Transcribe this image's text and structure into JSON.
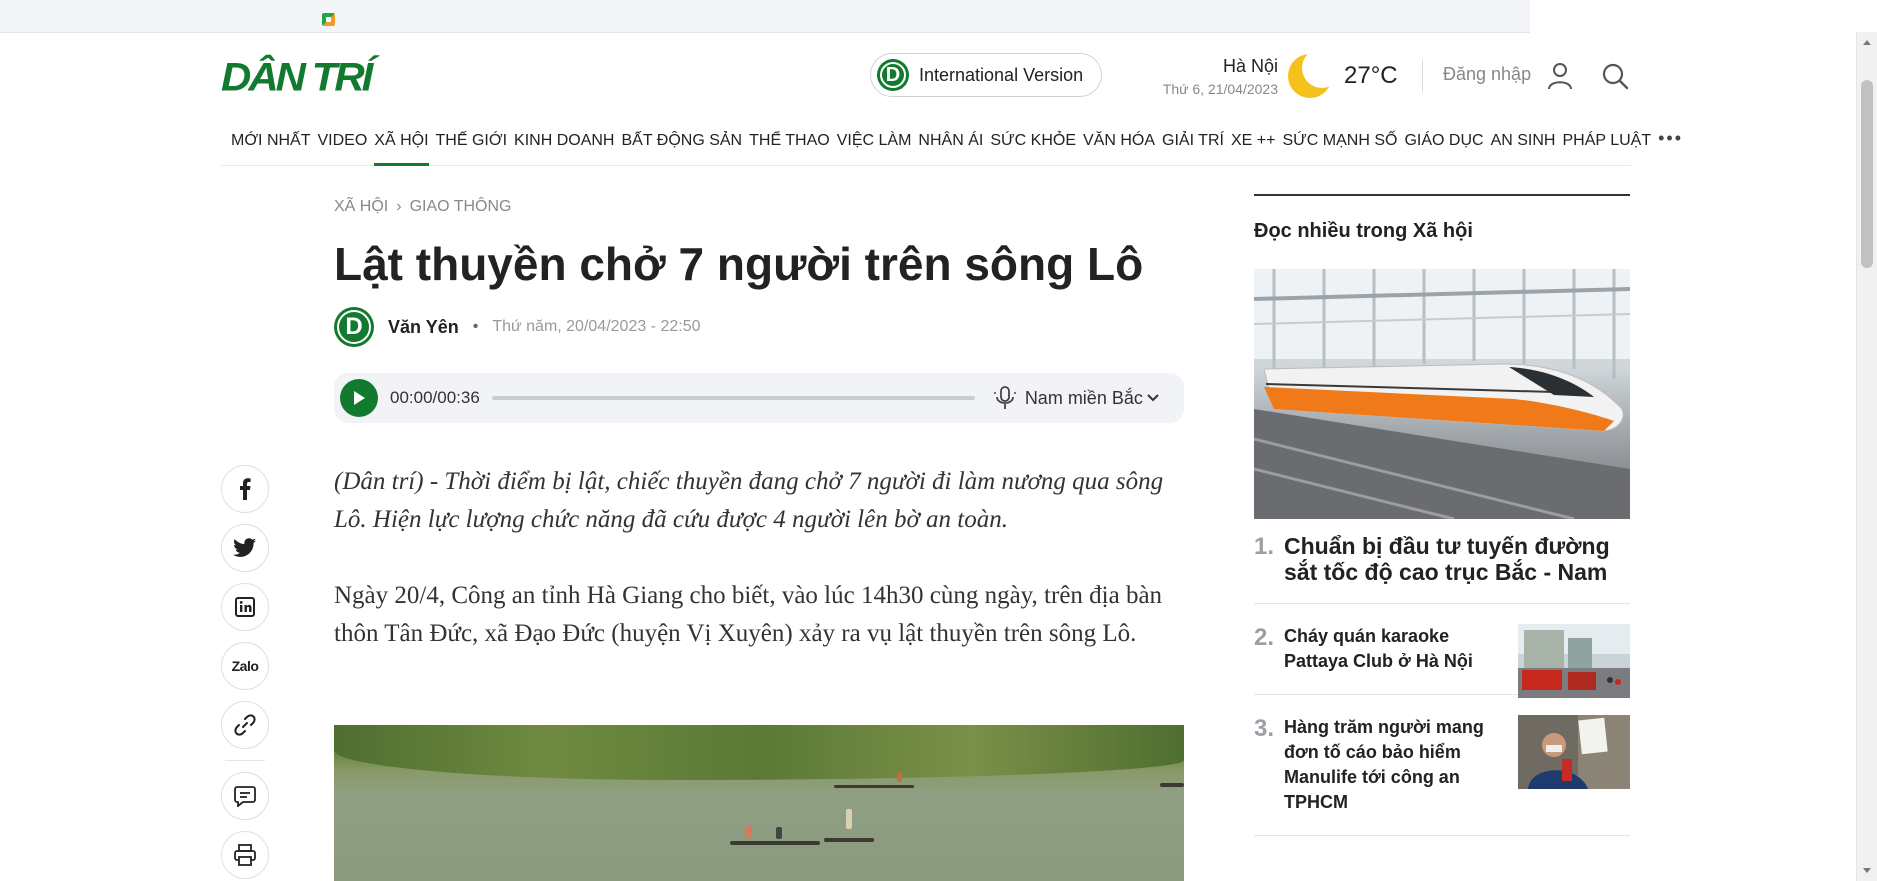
{
  "header": {
    "logo": "DÂN TRÍ",
    "intl_badge": "D",
    "intl_label": "International Version",
    "city": "Hà Nội",
    "date": "Thứ 6, 21/04/2023",
    "temperature": "27°C",
    "login_label": "Đăng nhập"
  },
  "nav": {
    "items": [
      "MỚI NHẤT",
      "VIDEO",
      "XÃ HỘI",
      "THẾ GIỚI",
      "KINH DOANH",
      "BẤT ĐỘNG SẢN",
      "THỂ THAO",
      "VIỆC LÀM",
      "NHÂN ÁI",
      "SỨC KHỎE",
      "VĂN HÓA",
      "GIẢI TRÍ",
      "XE ++",
      "SỨC MẠNH SỐ",
      "GIÁO DỤC",
      "AN SINH",
      "PHÁP LUẬT"
    ],
    "active": "XÃ HỘI",
    "more": "•••"
  },
  "breadcrumb": {
    "parent": "XÃ HỘI",
    "separator": "›",
    "child": "GIAO THÔNG"
  },
  "article": {
    "title": "Lật thuyền chở 7 người trên sông Lô",
    "author_badge": "D",
    "author": "Văn Yên",
    "bullet": "•",
    "published": "Thứ năm, 20/04/2023 - 22:50",
    "sapo": "(Dân trí) - Thời điểm bị lật, chiếc thuyền đang chở 7 người đi làm nương qua sông Lô. Hiện lực lượng chức năng đã cứu được 4 người lên bờ an toàn.",
    "paragraph": "Ngày 20/4, Công an tỉnh Hà Giang cho biết, vào lúc 14h30 cùng ngày, trên địa bàn thôn Tân Đức, xã Đạo Đức (huyện Vị Xuyên) xảy ra vụ lật thuyền trên sông Lô."
  },
  "player": {
    "time": "00:00/00:36",
    "voice": "Nam miền Bắc",
    "progress_fraction": 0
  },
  "share": {
    "zalo_label": "Zalo"
  },
  "sidebar": {
    "heading": "Đọc nhiều trong Xã hội",
    "items": [
      {
        "rank": "1.",
        "title": "Chuẩn bị đầu tư tuyến đường sắt tốc độ cao trục Bắc - Nam"
      },
      {
        "rank": "2.",
        "title": "Cháy quán karaoke Pattaya Club ở Hà Nội"
      },
      {
        "rank": "3.",
        "title": "Hàng trăm người mang đơn tố cáo bảo hiểm Manulife tới công an TPHCM"
      }
    ]
  },
  "colors": {
    "brand_green": "#127a2e",
    "moon": "#f4c21a",
    "muted": "#888888"
  }
}
